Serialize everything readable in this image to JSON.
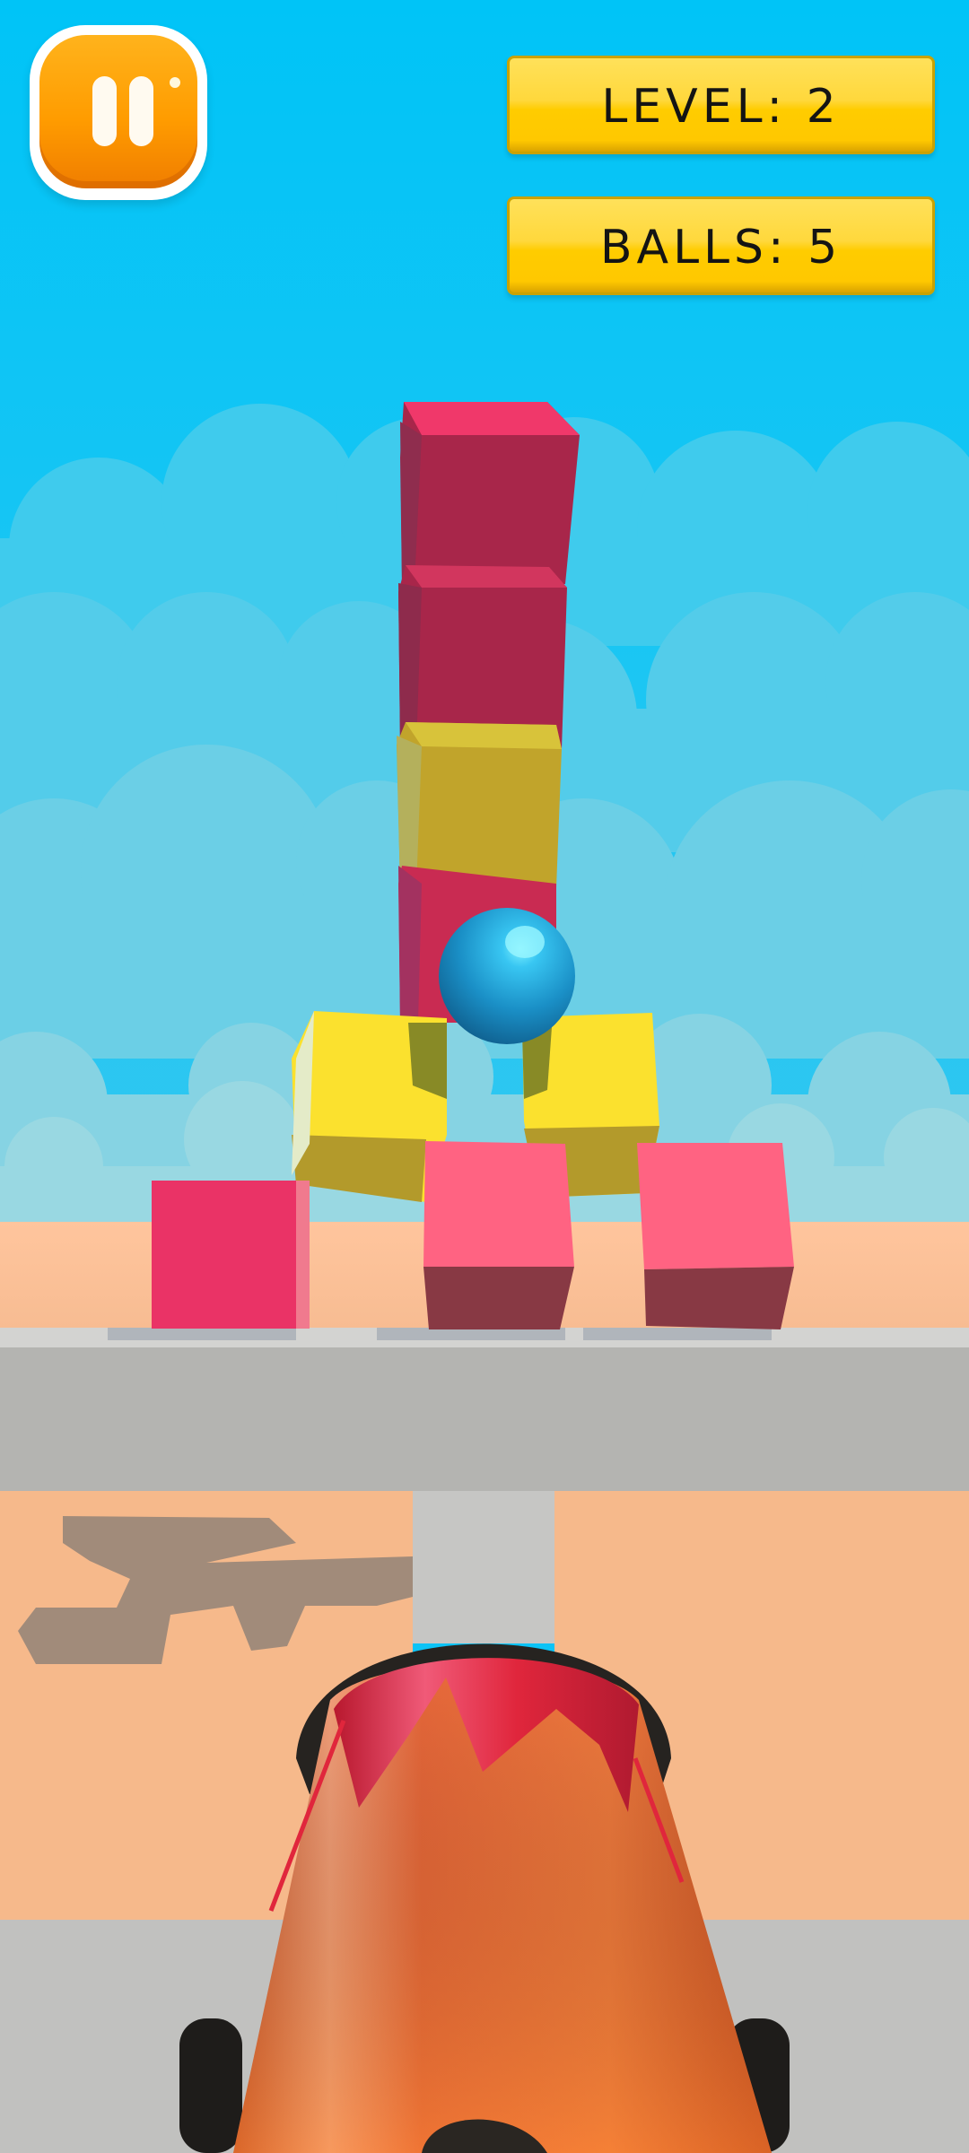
{
  "hud": {
    "level_text": "LEVEL: 2",
    "balls_text": "BALLS: 5"
  },
  "colors": {
    "sky": "#0bc3f6",
    "pause_orange": "#ff9c00",
    "hud_yellow": "#ffd21c",
    "block_magenta": "#ea3366",
    "block_crimson": "#a8264a",
    "block_mustard": "#c8ac2c",
    "block_yellow": "#fbe12e",
    "block_pink": "#ff6382",
    "ball_blue": "#1f9bd0",
    "cannon_orange": "#f06a2c",
    "cannon_rim_red": "#e0263c"
  },
  "icons": {
    "pause": "pause-icon"
  }
}
